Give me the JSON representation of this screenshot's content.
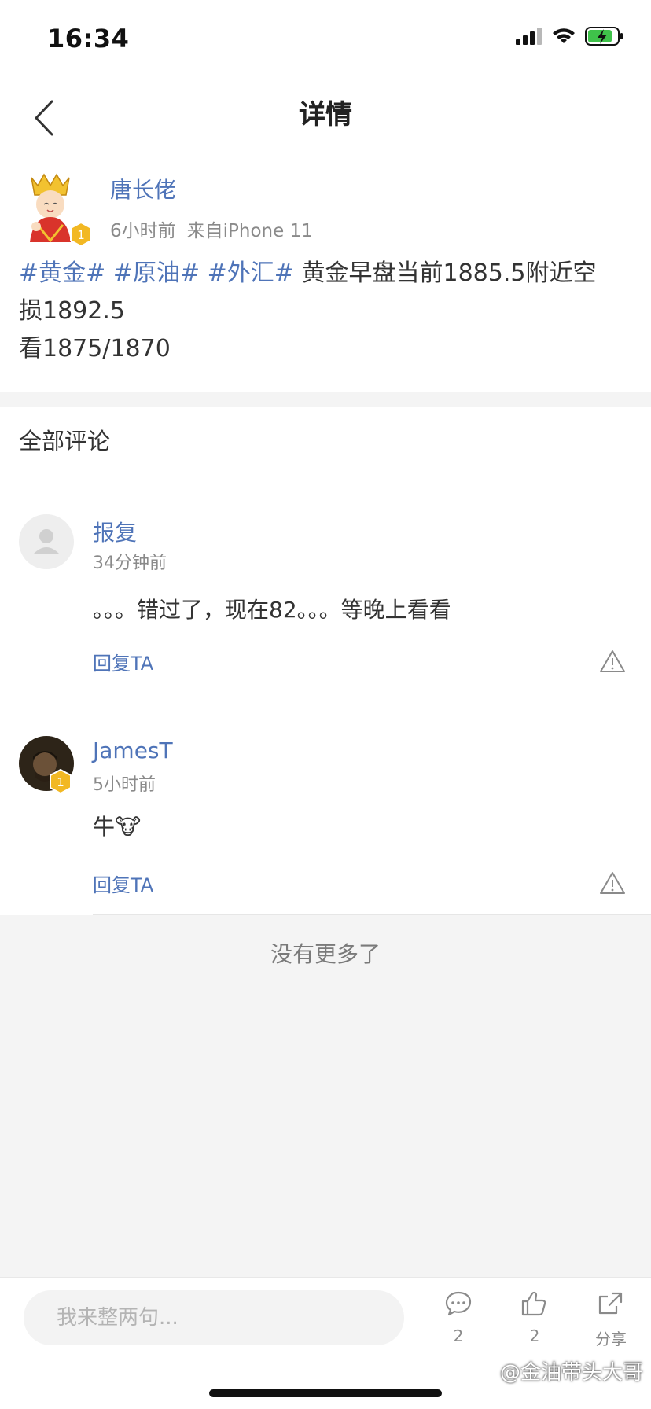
{
  "status_bar": {
    "time": "16:34"
  },
  "nav": {
    "title": "详情"
  },
  "post": {
    "author": "唐长佬",
    "time": "6小时前",
    "source": "来自iPhone 11",
    "avatar_badge": "1",
    "hashtags": [
      "#黄金#",
      "#原油#",
      "#外汇#"
    ],
    "line1_text": "黄金早盘当前1885.5附近空",
    "line2": "损1892.5",
    "line3": "看1875/1870"
  },
  "comments": {
    "header": "全部评论",
    "items": [
      {
        "name": "报复",
        "time": "34分钟前",
        "text": "。。。错过了，现在82。。。等晚上看看",
        "reply_label": "回复TA"
      },
      {
        "name": "JamesT",
        "time": "5小时前",
        "text": "牛🐮",
        "reply_label": "回复TA",
        "badge": "1"
      }
    ]
  },
  "no_more": "没有更多了",
  "bottom_bar": {
    "input_placeholder": "我来整两句...",
    "comment_count": "2",
    "like_count": "2",
    "share_label": "分享"
  },
  "watermark": "@金油带头大哥",
  "colors": {
    "link": "#4f74b8",
    "badge": "#f2b823",
    "background": "#f4f4f4"
  }
}
